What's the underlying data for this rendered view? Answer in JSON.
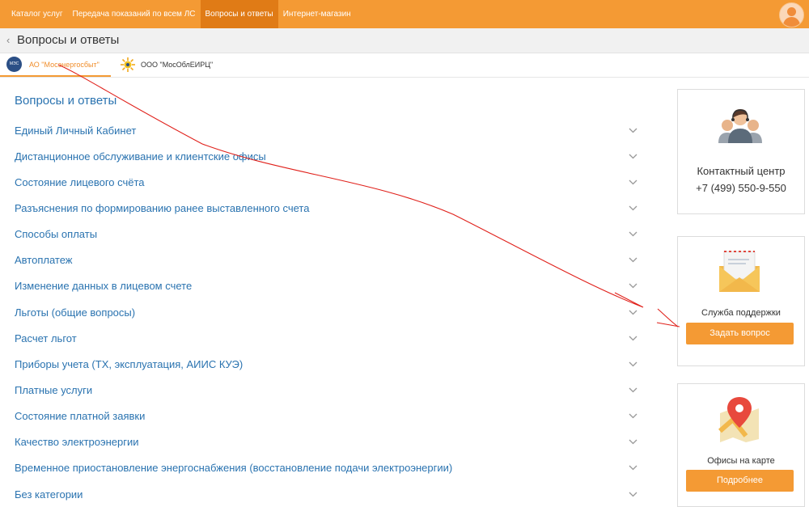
{
  "topnav": {
    "items": [
      {
        "label": "Каталог услуг"
      },
      {
        "label": "Передача показаний по всем ЛС"
      },
      {
        "label": "Вопросы и ответы"
      },
      {
        "label": "Интернет-магазин"
      }
    ],
    "active_index": 2
  },
  "page": {
    "back_icon": "‹",
    "title": "Вопросы и ответы"
  },
  "tabs": [
    {
      "label": "АО \"Мосэнергосбыт\"",
      "logo_text": "МЭС"
    },
    {
      "label": "ООО \"МосОблЕИРЦ\""
    }
  ],
  "faq": {
    "title": "Вопросы и ответы",
    "items": [
      "Единый Личный Кабинет",
      "Дистанционное обслуживание и клиентские офисы",
      "Состояние лицевого счёта",
      "Разъяснения по формированию ранее выставленного счета",
      "Способы оплаты",
      "Автоплатеж",
      "Изменение данных в лицевом счете",
      "Льготы (общие вопросы)",
      "Расчет льгот",
      "Приборы учета (ТХ, эксплуатация, АИИС КУЭ)",
      "Платные услуги",
      "Состояние платной заявки",
      "Качество электроэнергии",
      "Временное приостановление энергоснабжения (восстановление подачи электроэнергии)",
      "Без категории"
    ]
  },
  "sidebar": {
    "contact": {
      "title": "Контактный центр",
      "phone": "+7 (499) 550-9-550"
    },
    "support": {
      "title": "Служба поддержки",
      "button": "Задать вопрос"
    },
    "offices": {
      "title": "Офисы на карте",
      "button": "Подробнее"
    }
  },
  "colors": {
    "accent": "#f49a34",
    "link": "#2a73b0",
    "annotation": "#e0201a"
  }
}
